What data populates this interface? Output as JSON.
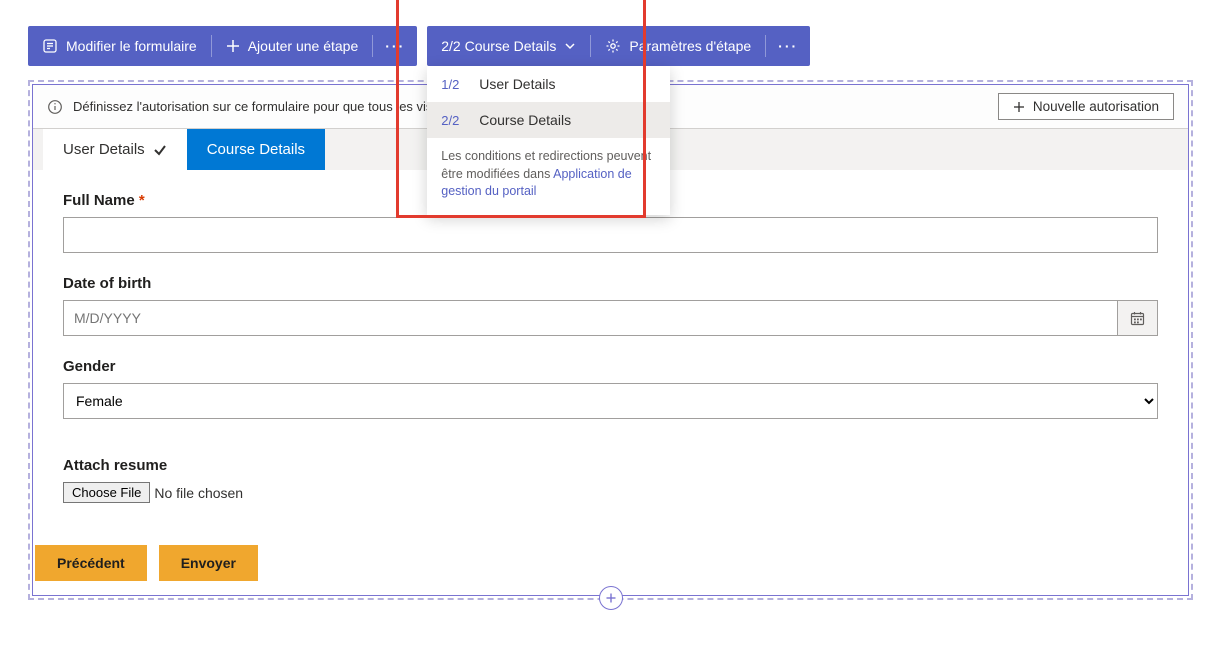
{
  "toolbar1": {
    "edit_form": "Modifier le formulaire",
    "add_step": "Ajouter une étape"
  },
  "toolbar2": {
    "step_indicator": "2/2 Course Details",
    "step_settings": "Paramètres d'étape"
  },
  "dropdown": {
    "items": [
      {
        "num": "1/2",
        "label": "User Details"
      },
      {
        "num": "2/2",
        "label": "Course Details"
      }
    ],
    "footer_text1": "Les conditions et redirections peuvent être modifiées dans ",
    "footer_link": "Application de gestion du portail"
  },
  "info_bar": {
    "message": "Définissez l'autorisation sur ce formulaire pour que tous les visiteurs d",
    "new_auth_btn": "Nouvelle autorisation"
  },
  "steps": {
    "tab1": "User Details",
    "tab2": "Course Details"
  },
  "form": {
    "full_name_label": "Full Name",
    "dob_label": "Date of birth",
    "dob_placeholder": "M/D/YYYY",
    "gender_label": "Gender",
    "gender_value": "Female",
    "attach_label": "Attach resume",
    "choose_file": "Choose File",
    "no_file": "No file chosen"
  },
  "nav": {
    "prev": "Précédent",
    "send": "Envoyer"
  }
}
